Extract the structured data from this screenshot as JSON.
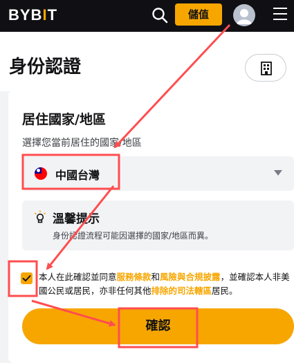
{
  "header": {
    "logo_main": "BYB",
    "logo_accent": "I",
    "logo_end": "T",
    "deposit_label": "儲值",
    "icons": [
      "search-icon",
      "avatar",
      "menu-icon"
    ]
  },
  "page": {
    "title": "身份認證",
    "title_icon": "building-icon"
  },
  "residence": {
    "title": "居住國家/地區",
    "subtitle": "選擇您當前居住的國家/地區",
    "selected_country": "中國台灣",
    "flag_icon": "taiwan-flag-icon"
  },
  "tip": {
    "icon": "lightbulb-icon",
    "title": "溫馨提示",
    "body": "身份認證流程可能因選擇的國家/地區而異。"
  },
  "consent": {
    "checked": true,
    "text_1": "本人在此確認並同意",
    "link_1": "服務條款",
    "text_2": "和",
    "link_2": "風險與合規披露",
    "text_3": "，並確認本人非美國公民或居民，亦非任何其他",
    "link_3": "排除的司法轄區",
    "text_4": "居民。"
  },
  "confirm_label": "確認",
  "colors": {
    "brand": "#f7a600",
    "header_bg": "#101014",
    "annotation": "#ff4d4f"
  }
}
